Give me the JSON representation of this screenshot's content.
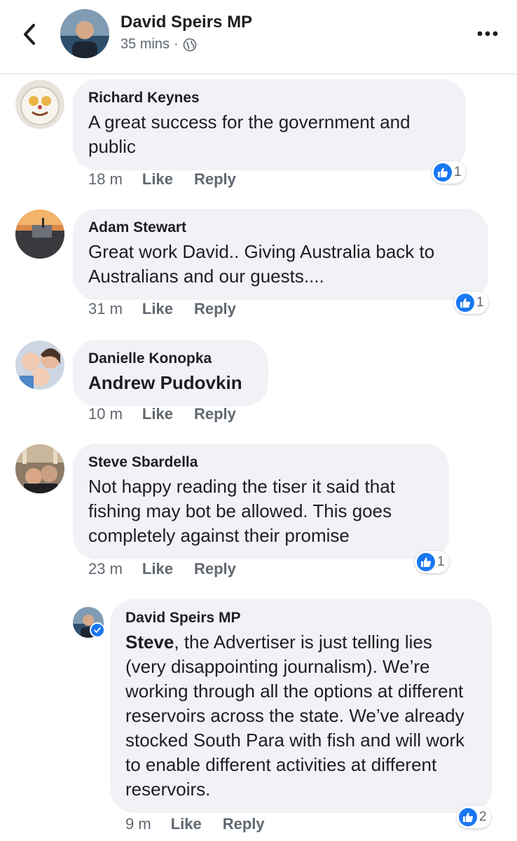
{
  "header": {
    "title": "David Speirs MP",
    "time": "35 mins",
    "separator": "·",
    "privacy_icon": "globe-icon"
  },
  "icons": {
    "back": "chevron-left-icon",
    "more": "ellipsis-icon",
    "reaction": "like-thumb-icon"
  },
  "colors": {
    "accent": "#1877f2",
    "bubble": "#f0f2f5",
    "meta": "#606770"
  },
  "comments": [
    {
      "author": "Richard Keynes",
      "text": "A great success for the government and public",
      "time": "18 m",
      "like_label": "Like",
      "reply_label": "Reply",
      "reactions": "1"
    },
    {
      "author": "Adam Stewart",
      "text": "Great work David.. Giving Australia back to Australians and our guests....",
      "time": "31 m",
      "like_label": "Like",
      "reply_label": "Reply",
      "reactions": "1"
    },
    {
      "author": "Danielle Konopka",
      "text": "Andrew Pudovkin",
      "time": "10 m",
      "like_label": "Like",
      "reply_label": "Reply"
    },
    {
      "author": "Steve Sbardella",
      "text": "Not happy reading the tiser it said that fishing may bot be allowed. This goes completely against their promise",
      "time": "23 m",
      "like_label": "Like",
      "reply_label": "Reply",
      "reactions": "1"
    }
  ],
  "reply": {
    "author": "David Speirs MP",
    "mention": "Steve",
    "text": ", the Advertiser is just telling lies (very disappointing journalism). We’re working through all the options at different reservoirs across the state. We’ve already stocked South Para with fish and will work to enable different activities at different reservoirs.",
    "time": "9 m",
    "like_label": "Like",
    "reply_label": "Reply",
    "reactions": "2"
  }
}
